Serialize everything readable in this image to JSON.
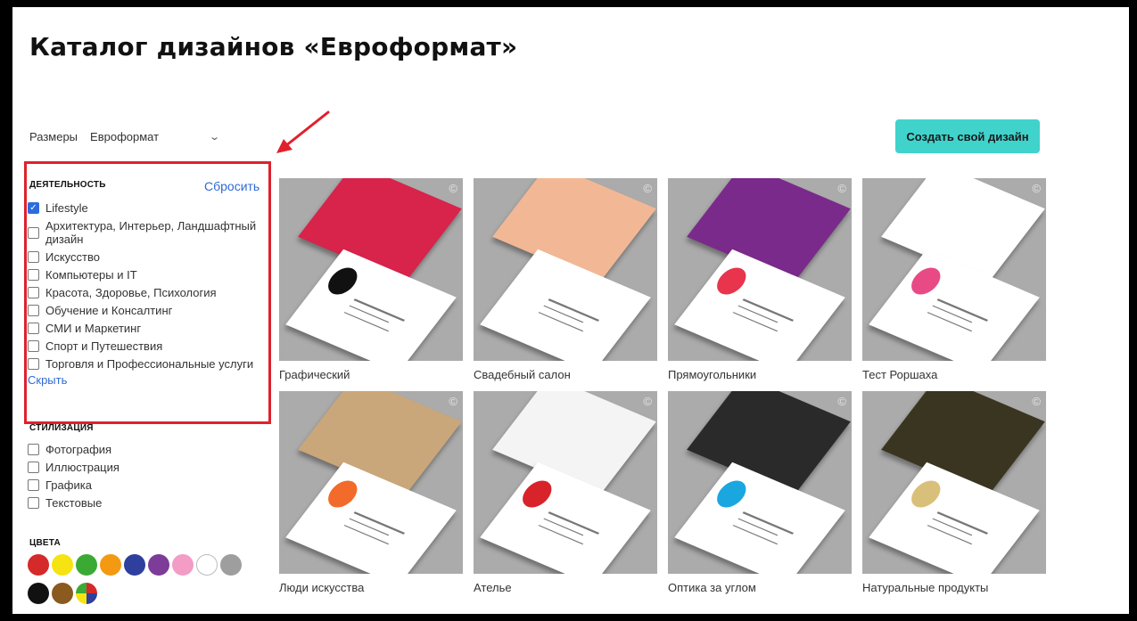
{
  "page": {
    "title": "Каталог дизайнов «Евроформат»"
  },
  "sizes": {
    "label": "Размеры",
    "selected": "Евроформат"
  },
  "actions": {
    "create_label": "Создать свой дизайн"
  },
  "filters": {
    "activity": {
      "heading": "ДЕЯТЕЛЬНОСТЬ",
      "reset_label": "Сбросить",
      "hide_label": "Скрыть",
      "items": [
        {
          "label": "Lifestyle",
          "checked": true
        },
        {
          "label": "Архитектура, Интерьер, Ландшафтный дизайн",
          "checked": false
        },
        {
          "label": "Искусство",
          "checked": false
        },
        {
          "label": "Компьютеры и IT",
          "checked": false
        },
        {
          "label": "Красота, Здоровье, Психология",
          "checked": false
        },
        {
          "label": "Обучение и Консалтинг",
          "checked": false
        },
        {
          "label": "СМИ и Маркетинг",
          "checked": false
        },
        {
          "label": "Спорт и Путешествия",
          "checked": false
        },
        {
          "label": "Торговля и Профессиональные услуги",
          "checked": false
        }
      ]
    },
    "stylization": {
      "heading": "СТИЛИЗАЦИЯ",
      "items": [
        {
          "label": "Фотография",
          "checked": false
        },
        {
          "label": "Иллюстрация",
          "checked": false
        },
        {
          "label": "Графика",
          "checked": false
        },
        {
          "label": "Текстовые",
          "checked": false
        }
      ]
    },
    "colors": {
      "heading": "ЦВЕТА",
      "swatches": [
        {
          "name": "red",
          "color": "#d42a2a"
        },
        {
          "name": "yellow",
          "color": "#f5e312"
        },
        {
          "name": "green",
          "color": "#3aaa35"
        },
        {
          "name": "orange",
          "color": "#f39a12"
        },
        {
          "name": "blue",
          "color": "#2e3f9e"
        },
        {
          "name": "purple",
          "color": "#7d3c98"
        },
        {
          "name": "pink",
          "color": "#f29cc6"
        },
        {
          "name": "white",
          "color": "#ffffff"
        },
        {
          "name": "gray",
          "color": "#9e9e9e"
        },
        {
          "name": "black",
          "color": "#111111"
        },
        {
          "name": "brown",
          "color": "#8b5a1e"
        },
        {
          "name": "multicolor",
          "color": "multi"
        }
      ]
    }
  },
  "designs": [
    {
      "title": "Графический",
      "icon": "copyright-icon",
      "back_color": "#d8234a",
      "accent": "#111111"
    },
    {
      "title": "Свадебный салон",
      "icon": "copyright-icon",
      "back_color": "#f2b896",
      "accent": "#ffffff"
    },
    {
      "title": "Прямоугольники",
      "icon": "copyright-icon",
      "back_color": "#7a2a8a",
      "accent": "#e8344c"
    },
    {
      "title": "Тест Роршаха",
      "icon": "copyright-icon",
      "back_color": "#ffffff",
      "accent": "#e84a86"
    },
    {
      "title": "Люди искусства",
      "icon": "copyright-icon",
      "back_color": "#c9a77a",
      "accent": "#f26b2a"
    },
    {
      "title": "Ателье",
      "icon": "copyright-icon",
      "back_color": "#f4f4f4",
      "accent": "#d8232a"
    },
    {
      "title": "Оптика за углом",
      "icon": "copyright-icon",
      "back_color": "#2a2a2a",
      "accent": "#1aa7e0"
    },
    {
      "title": "Натуральные продукты",
      "icon": "copyright-icon",
      "back_color": "#3a3520",
      "accent": "#d9c07a"
    }
  ]
}
